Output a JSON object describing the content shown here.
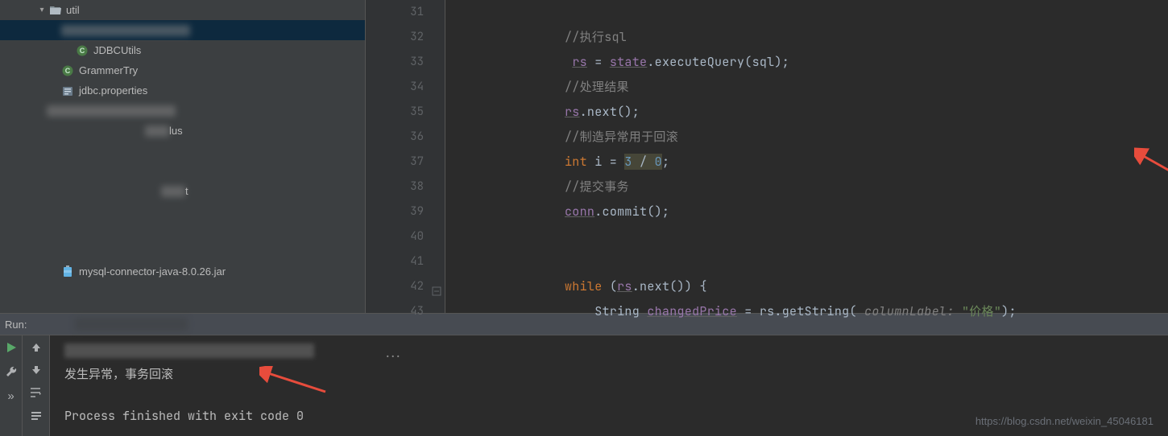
{
  "sidebar": {
    "items": [
      {
        "label": "util",
        "kind": "folder-open",
        "indent": 44,
        "expanded": true,
        "selected": false,
        "blurred": false,
        "showArrow": true
      },
      {
        "label": "",
        "kind": "blur",
        "indent": 76,
        "selected": true,
        "blurred": true
      },
      {
        "label": "JDBCUtils",
        "kind": "class",
        "indent": 94,
        "selected": false
      },
      {
        "label": "GrammerTry",
        "kind": "class",
        "indent": 76,
        "selected": false
      },
      {
        "label": "jdbc.properties",
        "kind": "props",
        "indent": 76,
        "selected": false
      },
      {
        "label": "",
        "kind": "blur",
        "indent": 58,
        "blurred": true
      },
      {
        "label": "lus",
        "kind": "blurpartial",
        "indent": 180,
        "blurred": true
      },
      {
        "label": "",
        "kind": "spacer"
      },
      {
        "label": "",
        "kind": "spacer"
      },
      {
        "label": "t",
        "kind": "blurpartial",
        "indent": 200,
        "blurred": true
      },
      {
        "label": "",
        "kind": "spacer"
      },
      {
        "label": "",
        "kind": "spacer"
      },
      {
        "label": "",
        "kind": "spacer"
      },
      {
        "label": "mysql-connector-java-8.0.26.jar",
        "kind": "jar",
        "indent": 76,
        "selected": false
      }
    ]
  },
  "gutter": {
    "start": 31,
    "end": 43,
    "collapseAt": 42
  },
  "code": {
    "lines": [
      {
        "n": 31,
        "segs": []
      },
      {
        "n": 32,
        "segs": [
          {
            "t": "//执行sql",
            "cls": "c-comment"
          }
        ]
      },
      {
        "n": 33,
        "segs": [
          {
            "t": " ",
            "cls": "c-ident"
          },
          {
            "t": "rs",
            "cls": "c-field"
          },
          {
            "t": " = ",
            "cls": "c-ident"
          },
          {
            "t": "state",
            "cls": "c-field"
          },
          {
            "t": ".",
            "cls": "c-ident"
          },
          {
            "t": "executeQuery",
            "cls": "c-ident"
          },
          {
            "t": "(sql);",
            "cls": "c-ident"
          }
        ]
      },
      {
        "n": 34,
        "segs": [
          {
            "t": "//处理结果",
            "cls": "c-comment"
          }
        ]
      },
      {
        "n": 35,
        "segs": [
          {
            "t": "rs",
            "cls": "c-field"
          },
          {
            "t": ".",
            "cls": "c-ident"
          },
          {
            "t": "next",
            "cls": "c-ident"
          },
          {
            "t": "();",
            "cls": "c-ident"
          }
        ]
      },
      {
        "n": 36,
        "segs": [
          {
            "t": "//制造异常用于回滚",
            "cls": "c-comment"
          }
        ]
      },
      {
        "n": 37,
        "segs": [
          {
            "t": "int ",
            "cls": "c-keyword"
          },
          {
            "t": "i = ",
            "cls": "c-ident"
          },
          {
            "t": "3",
            "cls": "c-num hl-box"
          },
          {
            "t": " / ",
            "cls": "c-ident hl-box"
          },
          {
            "t": "0",
            "cls": "c-num hl-box"
          },
          {
            "t": ";",
            "cls": "c-ident"
          }
        ]
      },
      {
        "n": 38,
        "segs": [
          {
            "t": "//提交事务",
            "cls": "c-comment"
          }
        ]
      },
      {
        "n": 39,
        "segs": [
          {
            "t": "conn",
            "cls": "c-field"
          },
          {
            "t": ".",
            "cls": "c-ident"
          },
          {
            "t": "commit",
            "cls": "c-ident"
          },
          {
            "t": "();",
            "cls": "c-ident"
          }
        ]
      },
      {
        "n": 40,
        "segs": []
      },
      {
        "n": 41,
        "segs": []
      },
      {
        "n": 42,
        "segs": [
          {
            "t": "while ",
            "cls": "c-keyword"
          },
          {
            "t": "(",
            "cls": "c-ident"
          },
          {
            "t": "rs",
            "cls": "c-field"
          },
          {
            "t": ".",
            "cls": "c-ident"
          },
          {
            "t": "next",
            "cls": "c-ident"
          },
          {
            "t": "()) {",
            "cls": "c-ident"
          }
        ]
      },
      {
        "n": 43,
        "segs": [
          {
            "t": "    String ",
            "cls": "c-type"
          },
          {
            "t": "changedPrice",
            "cls": "c-field"
          },
          {
            "t": " = rs.getString( ",
            "cls": "c-ident"
          },
          {
            "t": "columnLabel: ",
            "cls": "c-param"
          },
          {
            "t": "\"价格\"",
            "cls": "c-string"
          },
          {
            "t": ");",
            "cls": "c-ident"
          }
        ]
      }
    ]
  },
  "run": {
    "title": "Run:",
    "console_line1": "发生异常，事务回滚",
    "console_line2": "Process finished with exit code 0",
    "ellipsis": "..."
  },
  "watermark": "https://blog.csdn.net/weixin_45046181",
  "colors": {
    "accent_green": "#59a869",
    "wrench": "#afb1b3",
    "arrow_red": "#e74c3c"
  }
}
